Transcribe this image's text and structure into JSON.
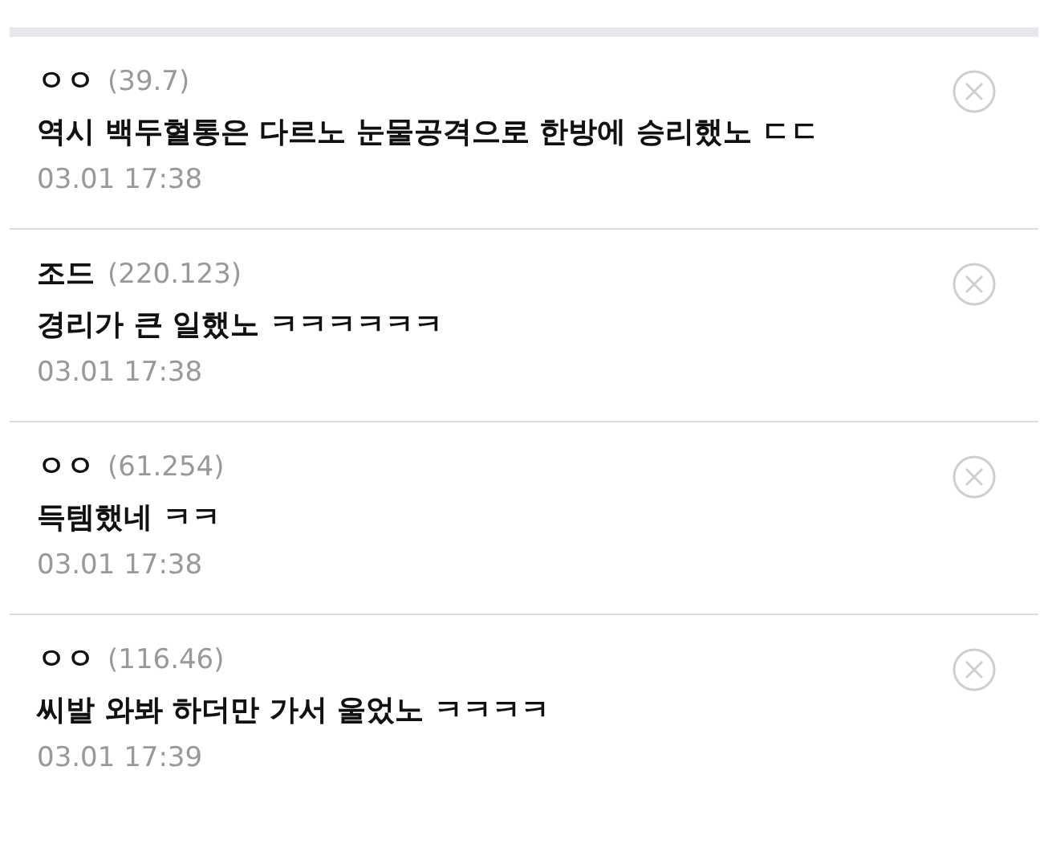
{
  "comments": [
    {
      "author": "ㅇㅇ",
      "ip": "(39.7)",
      "text": "역시 백두혈통은 다르노 눈물공격으로 한방에 승리했노 ㄷㄷ",
      "time": "03.01 17:38"
    },
    {
      "author": "조드",
      "ip": "(220.123)",
      "text": "경리가 큰 일했노 ㅋㅋㅋㅋㅋㅋ",
      "time": "03.01 17:38"
    },
    {
      "author": "ㅇㅇ",
      "ip": "(61.254)",
      "text": "득템했네 ㅋㅋ",
      "time": "03.01 17:38"
    },
    {
      "author": "ㅇㅇ",
      "ip": "(116.46)",
      "text": "씨발 와봐 하더만 가서 울었노 ㅋㅋㅋㅋ",
      "time": "03.01 17:39"
    }
  ]
}
